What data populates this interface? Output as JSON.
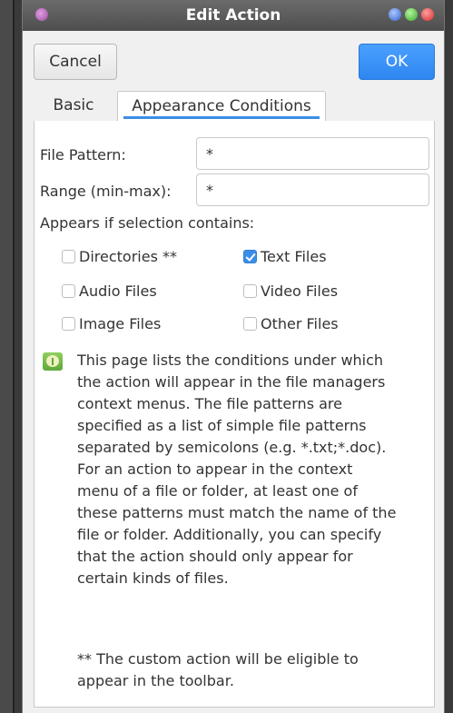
{
  "window": {
    "title": "Edit Action"
  },
  "buttons": {
    "cancel_label": "Cancel",
    "ok_label": "OK"
  },
  "tabs": [
    {
      "label": "Basic",
      "active": false
    },
    {
      "label": "Appearance Conditions",
      "active": true
    }
  ],
  "form": {
    "file_pattern_label": "File Pattern:",
    "file_pattern_value": "*",
    "range_label": "Range (min-max):",
    "range_value": "*",
    "appears_label": "Appears if selection contains:"
  },
  "checkboxes": [
    {
      "label": "Directories **",
      "checked": false
    },
    {
      "label": "Text Files",
      "checked": true
    },
    {
      "label": "Audio Files",
      "checked": false
    },
    {
      "label": "Video Files",
      "checked": false
    },
    {
      "label": "Image Files",
      "checked": false
    },
    {
      "label": "Other Files",
      "checked": false
    }
  ],
  "info": {
    "lines": [
      "This page lists the conditions under which",
      "the action will appear in the file managers",
      "context menus. The file patterns are",
      "specified as a list of simple file patterns",
      "separated by semicolons (e.g. *.txt;*.doc).",
      "For an action to appear in the context",
      "menu of a file or folder, at least one of",
      "these patterns must match the name of the",
      "file or folder. Additionally, you can specify",
      "that the action should only appear for",
      "certain kinds of files."
    ],
    "note_lines": [
      "** The custom action will be eligible to",
      "appear in the toolbar."
    ]
  },
  "colors": {
    "accent": "#3a8ee6",
    "ok_button": "#2e86f0",
    "titlebar": "#5a5a5a"
  },
  "icons": {
    "info": "info-icon"
  }
}
